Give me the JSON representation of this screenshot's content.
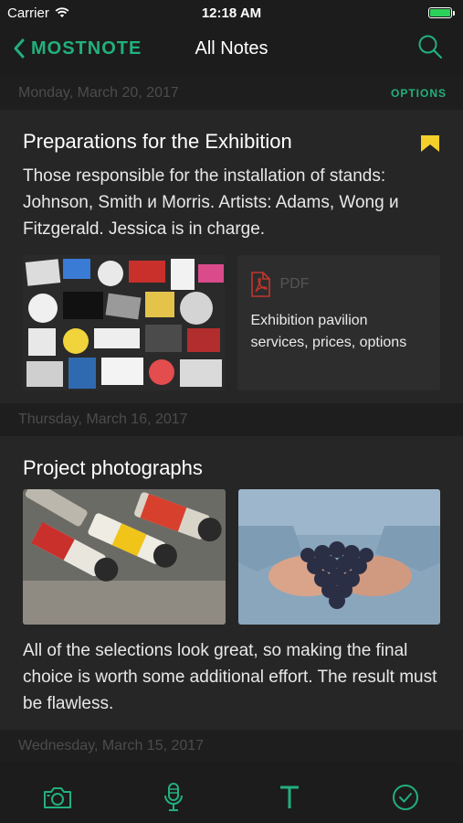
{
  "status": {
    "carrier": "Carrier",
    "time": "12:18 AM"
  },
  "nav": {
    "back_label": "MOSTNOTE",
    "title": "All Notes"
  },
  "sections": [
    {
      "date": "Monday, March 20, 2017",
      "options": "OPTIONS"
    },
    {
      "date": "Thursday, March 16, 2017"
    },
    {
      "date": "Wednesday, March 15, 2017"
    }
  ],
  "notes": [
    {
      "title": "Preparations for the Exhibition",
      "text": "Those responsible for the installation of stands: Johnson, Smith и Morris. Artists: Adams, Wong и Fitzgerald. Jessica is in charge.",
      "pdf_label": "PDF",
      "pdf_desc": "Exhibition pavilion services, prices, options"
    },
    {
      "title": "Project photographs",
      "text": "All of the selections look great, so making the final choice is worth some additional effort. The result must be flawless."
    }
  ],
  "colors": {
    "accent": "#22b07d",
    "bookmark": "#f5d02a",
    "pdf": "#c2362c"
  }
}
